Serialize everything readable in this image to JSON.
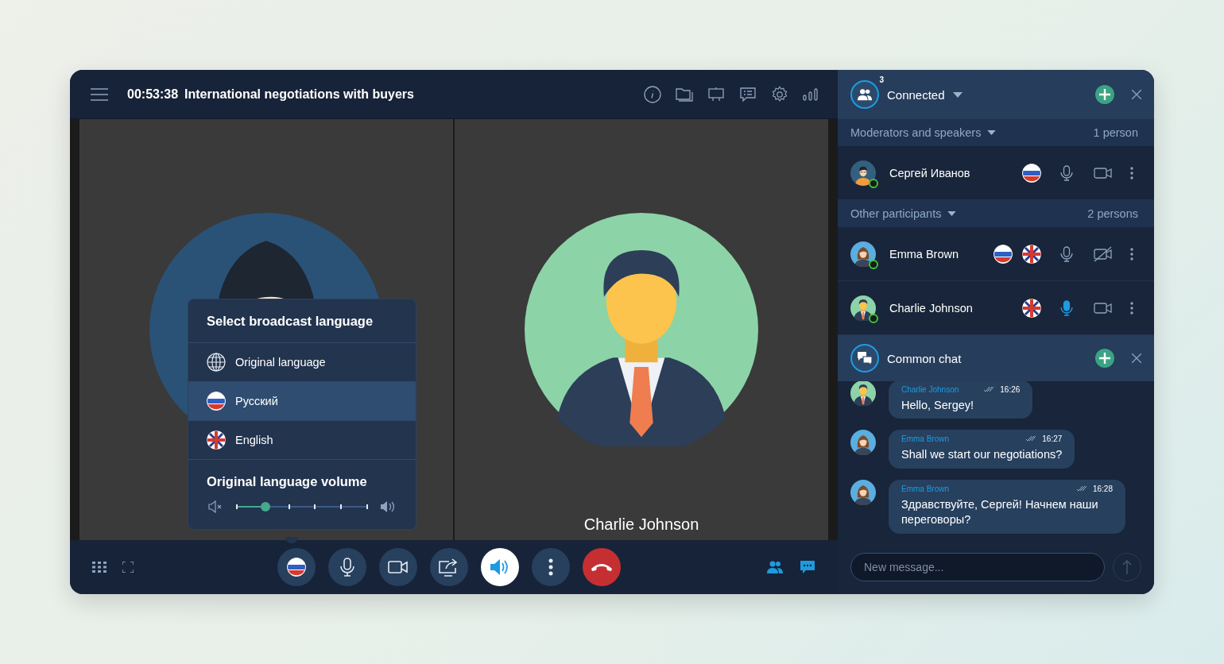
{
  "header": {
    "timer": "00:53:38",
    "title": "International negotiations with buyers"
  },
  "videos": [
    {
      "kind": "woman-dark"
    },
    {
      "kind": "man-green",
      "caption": "Charlie Johnson"
    }
  ],
  "language_menu": {
    "title": "Select broadcast language",
    "options": [
      {
        "label": "Original language",
        "kind": "globe",
        "selected": false
      },
      {
        "label": "Русский",
        "kind": "ru",
        "selected": true
      },
      {
        "label": "English",
        "kind": "gb",
        "selected": false
      }
    ],
    "volume_title": "Original language volume",
    "volume": {
      "level": 0.22
    }
  },
  "controls": [
    {
      "kind": "language",
      "active": false
    },
    {
      "kind": "mic",
      "active": false
    },
    {
      "kind": "camera",
      "active": false
    },
    {
      "kind": "share",
      "active": false
    },
    {
      "kind": "speaker",
      "active": true
    },
    {
      "kind": "more",
      "active": false
    },
    {
      "kind": "hang-up"
    }
  ],
  "participants": {
    "count": "3",
    "title": "Connected",
    "groups": [
      {
        "label": "Moderators and speakers",
        "count": "1 person",
        "members": [
          {
            "name": "Сергей Иванов",
            "kind": "man-dark",
            "online": true,
            "languages": [
              {
                "kind": "ru"
              }
            ],
            "mic_active": false,
            "camera_off": false
          }
        ]
      },
      {
        "label": "Other participants",
        "count": "2 persons",
        "members": [
          {
            "name": "Emma Brown",
            "kind": "woman",
            "online": true,
            "languages": [
              {
                "kind": "ru"
              },
              {
                "kind": "gb"
              }
            ],
            "mic_active": false,
            "camera_off": true
          },
          {
            "name": "Charlie Johnson",
            "kind": "man-green",
            "online": true,
            "languages": [
              {
                "kind": "gb"
              }
            ],
            "mic_active": true,
            "camera_off": false
          }
        ]
      }
    ]
  },
  "chat": {
    "title": "Common chat",
    "messages": [
      {
        "author": "Charlie Johnson",
        "kind": "man-green",
        "time": "16:26",
        "text": "Hello, Sergey!"
      },
      {
        "author": "Emma Brown",
        "kind": "woman",
        "time": "16:27",
        "text": "Shall we start our negotiations?"
      },
      {
        "author": "Emma Brown",
        "kind": "woman",
        "time": "16:28",
        "text": "Здравствуйте, Сергей! Начнем наши переговоры?"
      }
    ],
    "placeholder": "New message..."
  }
}
